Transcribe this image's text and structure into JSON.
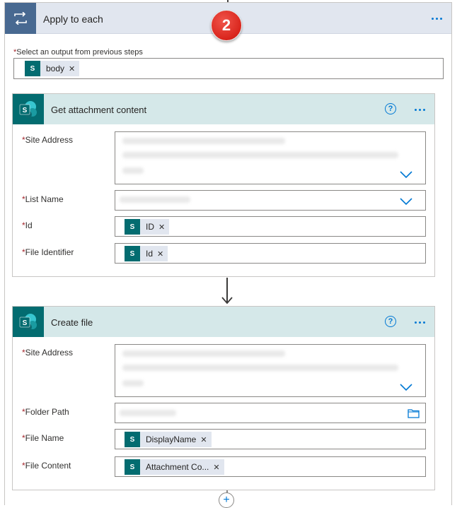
{
  "apply_to_each": {
    "title": "Apply to each",
    "step_badge": "2",
    "select_output_label": "Select an output from previous steps",
    "select_output_token": "body"
  },
  "get_attachment": {
    "title": "Get attachment content",
    "fields": {
      "site_address_label": "Site Address",
      "list_name_label": "List Name",
      "id_label": "Id",
      "id_token": "ID",
      "file_identifier_label": "File Identifier",
      "file_identifier_token": "Id"
    }
  },
  "create_file": {
    "title": "Create file",
    "fields": {
      "site_address_label": "Site Address",
      "folder_path_label": "Folder Path",
      "file_name_label": "File Name",
      "file_name_token": "DisplayName",
      "file_content_label": "File Content",
      "file_content_token": "Attachment Co..."
    }
  },
  "icons": {
    "loop": "loop-icon",
    "sharepoint": "sharepoint-icon",
    "more": "more-icon",
    "help": "help-icon",
    "chevron": "chevron-down-icon",
    "folder": "folder-icon",
    "remove": "close-icon",
    "add": "plus-icon"
  },
  "colors": {
    "loop_header": "#486991",
    "sharepoint": "#036c70",
    "card_header": "#d5e8e9",
    "accent": "#0078d4",
    "badge": "#d9251c",
    "required": "#a4262c"
  }
}
